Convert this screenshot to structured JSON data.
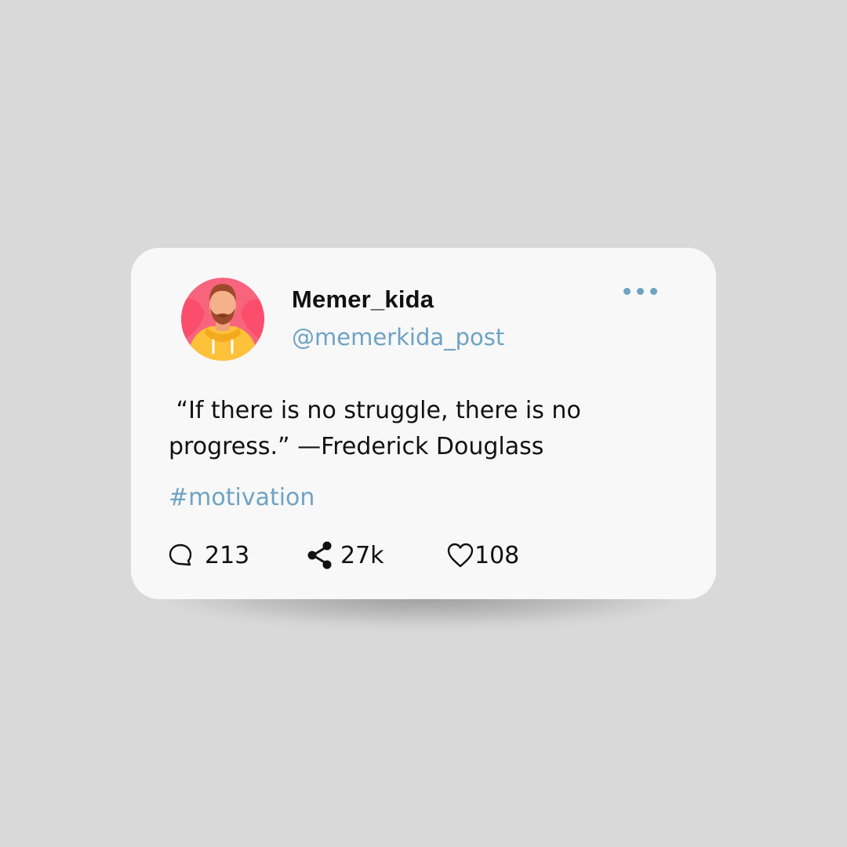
{
  "post": {
    "display_name": "Memer_kida",
    "handle": "@memerkida_post",
    "quote": " “If there is no struggle, there is no progress.” —Frederick Douglass",
    "hashtag": "#motivation",
    "avatar_icon": "bearded-man-avatar",
    "more_icon": "more-dots-icon"
  },
  "actions": {
    "comments": {
      "icon": "comment-icon",
      "count": "213"
    },
    "shares": {
      "icon": "share-icon",
      "count": "27k"
    },
    "likes": {
      "icon": "heart-icon",
      "count": "108"
    }
  },
  "colors": {
    "background": "#d9d9d9",
    "card": "#f8f8f8",
    "accent": "#6ea3c4",
    "text": "#111111"
  }
}
